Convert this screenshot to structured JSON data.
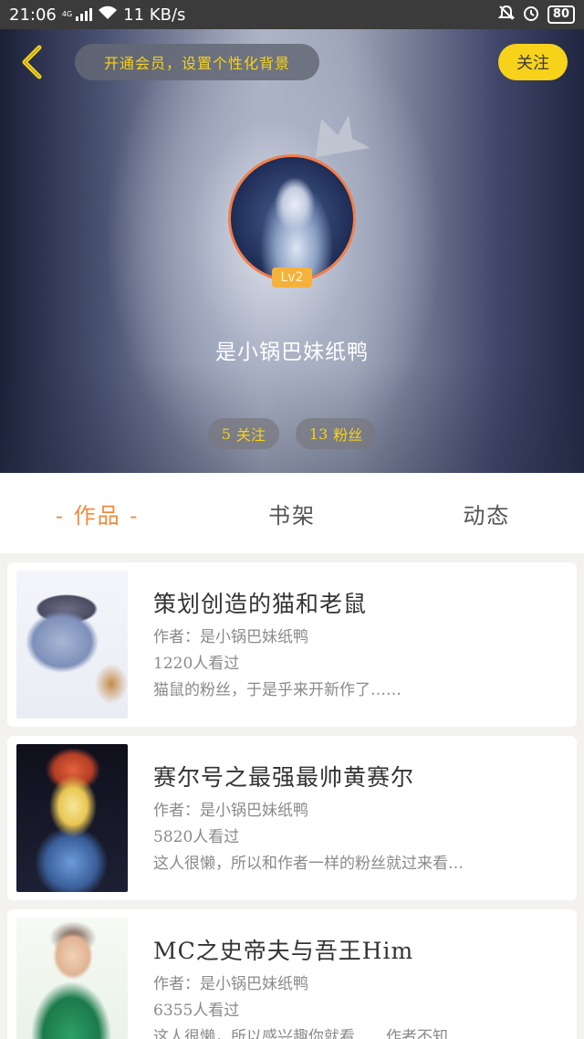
{
  "status_bar": {
    "time": "21:06",
    "network": "4G",
    "speed": "11 KB/s",
    "battery": "80",
    "icons": [
      "signal-icon",
      "wifi-icon",
      "bell-off-icon",
      "alarm-icon",
      "battery-icon"
    ]
  },
  "header": {
    "vip_banner": "开通会员，设置个性化背景",
    "follow_button": "关注",
    "level": "Lv2",
    "nickname": "是小锅巴妹纸鸭",
    "following_count": "5",
    "following_label": "关注",
    "fans_count": "13",
    "fans_label": "粉丝",
    "accent_color": "#f7d21b",
    "avatar_ring_color": "#f27e4a"
  },
  "tabs": [
    {
      "label": "- 作品 -",
      "active": true
    },
    {
      "label": "书架",
      "active": false
    },
    {
      "label": "动态",
      "active": false
    }
  ],
  "works": [
    {
      "title": "策划创造的猫和老鼠",
      "author": "作者：是小锅巴妹纸鸭",
      "views": "1220人看过",
      "desc": "猫鼠的粉丝，于是乎来开新作了……"
    },
    {
      "title": "赛尔号之最强最帅黄赛尔",
      "author": "作者：是小锅巴妹纸鸭",
      "views": "5820人看过",
      "desc": "这人很懒，所以和作者一样的粉丝就过来看…"
    },
    {
      "title": "MC之史帝夫与吾王Him",
      "author": "作者：是小锅巴妹纸鸭",
      "views": "6355人看过",
      "desc": "这人很懒，所以感兴趣你就看……作者不知…"
    }
  ]
}
